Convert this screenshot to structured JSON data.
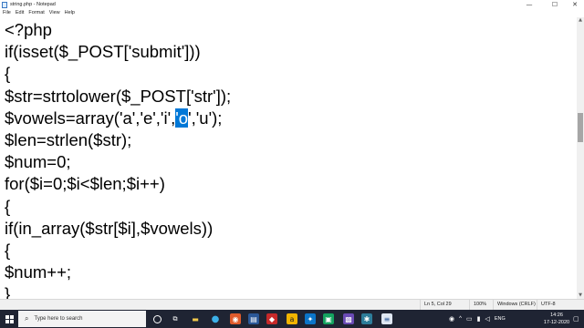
{
  "window": {
    "title": "string.php - Notepad",
    "controls": {
      "minimize": "—",
      "maximize": "☐",
      "close": "✕"
    }
  },
  "menu": {
    "items": [
      "File",
      "Edit",
      "Format",
      "View",
      "Help"
    ]
  },
  "editor": {
    "lines": [
      "<?php",
      "if(isset($_POST['submit']))",
      "{",
      "$str=strtolower($_POST['str']);",
      "$vowels=array('a','e','i',",
      "$len=strlen($str);",
      "$num=0;",
      "for($i=0;$i<$len;$i++)",
      "{",
      "if(in_array($str[$i],$vowels))",
      "{",
      "$num++;",
      "}"
    ],
    "vowels_selected": "'o",
    "vowels_after": "','u');",
    "selection_color": "#0078d7"
  },
  "statusbar": {
    "position": "Ln 5, Col 29",
    "zoom": "100%",
    "line_ending": "Windows (CRLF)",
    "encoding": "UTF-8"
  },
  "taskbar": {
    "search_placeholder": "Type here to search",
    "language": "ENG",
    "time": "14:26",
    "date": "17-12-2020",
    "background": "#1f2433"
  }
}
